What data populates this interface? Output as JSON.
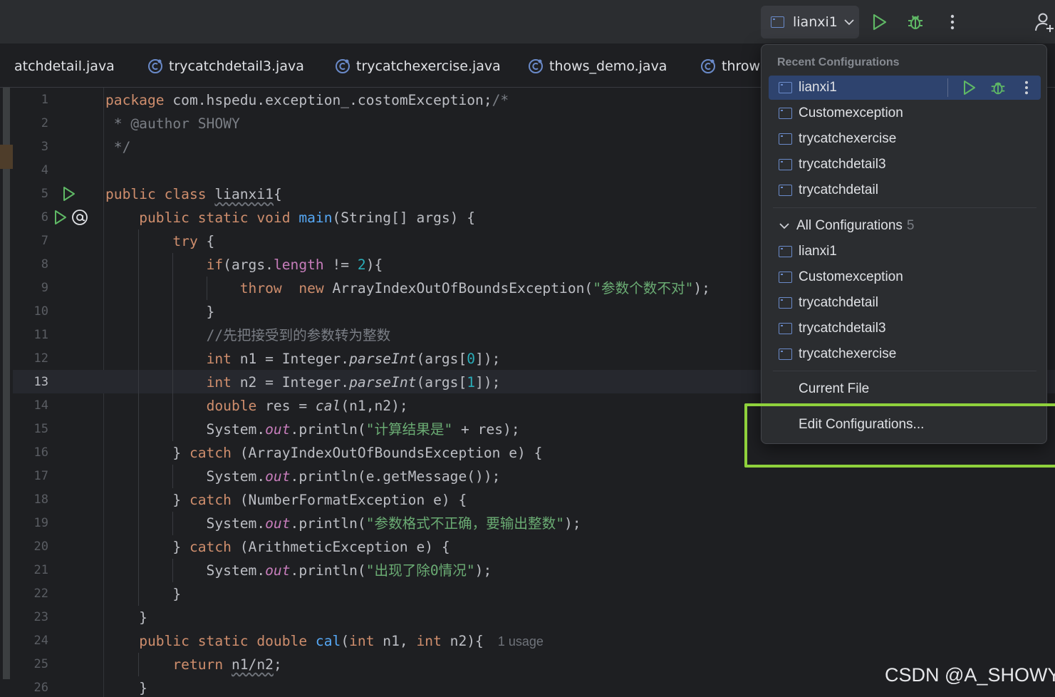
{
  "toolbar": {
    "run_config_label": "lianxi1",
    "icons": [
      "run-icon",
      "debug-icon",
      "more-vertical-icon",
      "add-user-icon"
    ]
  },
  "tabs": [
    {
      "label": "atchdetail.java"
    },
    {
      "label": "trycatchdetail3.java"
    },
    {
      "label": "trycatchexercise.java"
    },
    {
      "label": "thows_demo.java"
    },
    {
      "label": "throws"
    }
  ],
  "editor": {
    "current_line": 13,
    "line_numbers": [
      "1",
      "2",
      "3",
      "4",
      "5",
      "6",
      "7",
      "8",
      "9",
      "10",
      "11",
      "12",
      "13",
      "14",
      "15",
      "16",
      "17",
      "18",
      "19",
      "20",
      "21",
      "22",
      "23",
      "24",
      "25",
      "26"
    ],
    "inlay_hint": "1 usage"
  },
  "popup": {
    "recent_header": "Recent Configurations",
    "recent": [
      {
        "label": "lianxi1",
        "selected": true
      },
      {
        "label": "Customexception"
      },
      {
        "label": "trycatchexercise"
      },
      {
        "label": "trycatchdetail3"
      },
      {
        "label": "trycatchdetail"
      }
    ],
    "all_label": "All Configurations",
    "all_count": "5",
    "all": [
      {
        "label": "lianxi1"
      },
      {
        "label": "Customexception"
      },
      {
        "label": "trycatchdetail"
      },
      {
        "label": "trycatchdetail3"
      },
      {
        "label": "trycatchexercise"
      }
    ],
    "current_file": "Current File",
    "edit_configurations": "Edit Configurations..."
  },
  "colors": {
    "keyword": "#cf8e6d",
    "function": "#56a8f5",
    "string": "#6aab73",
    "number": "#2aacb8",
    "comment": "#7a7e85",
    "run_green": "#5fb865",
    "highlight_box": "#8fd13c"
  },
  "watermark": "CSDN @A_SHOWY"
}
